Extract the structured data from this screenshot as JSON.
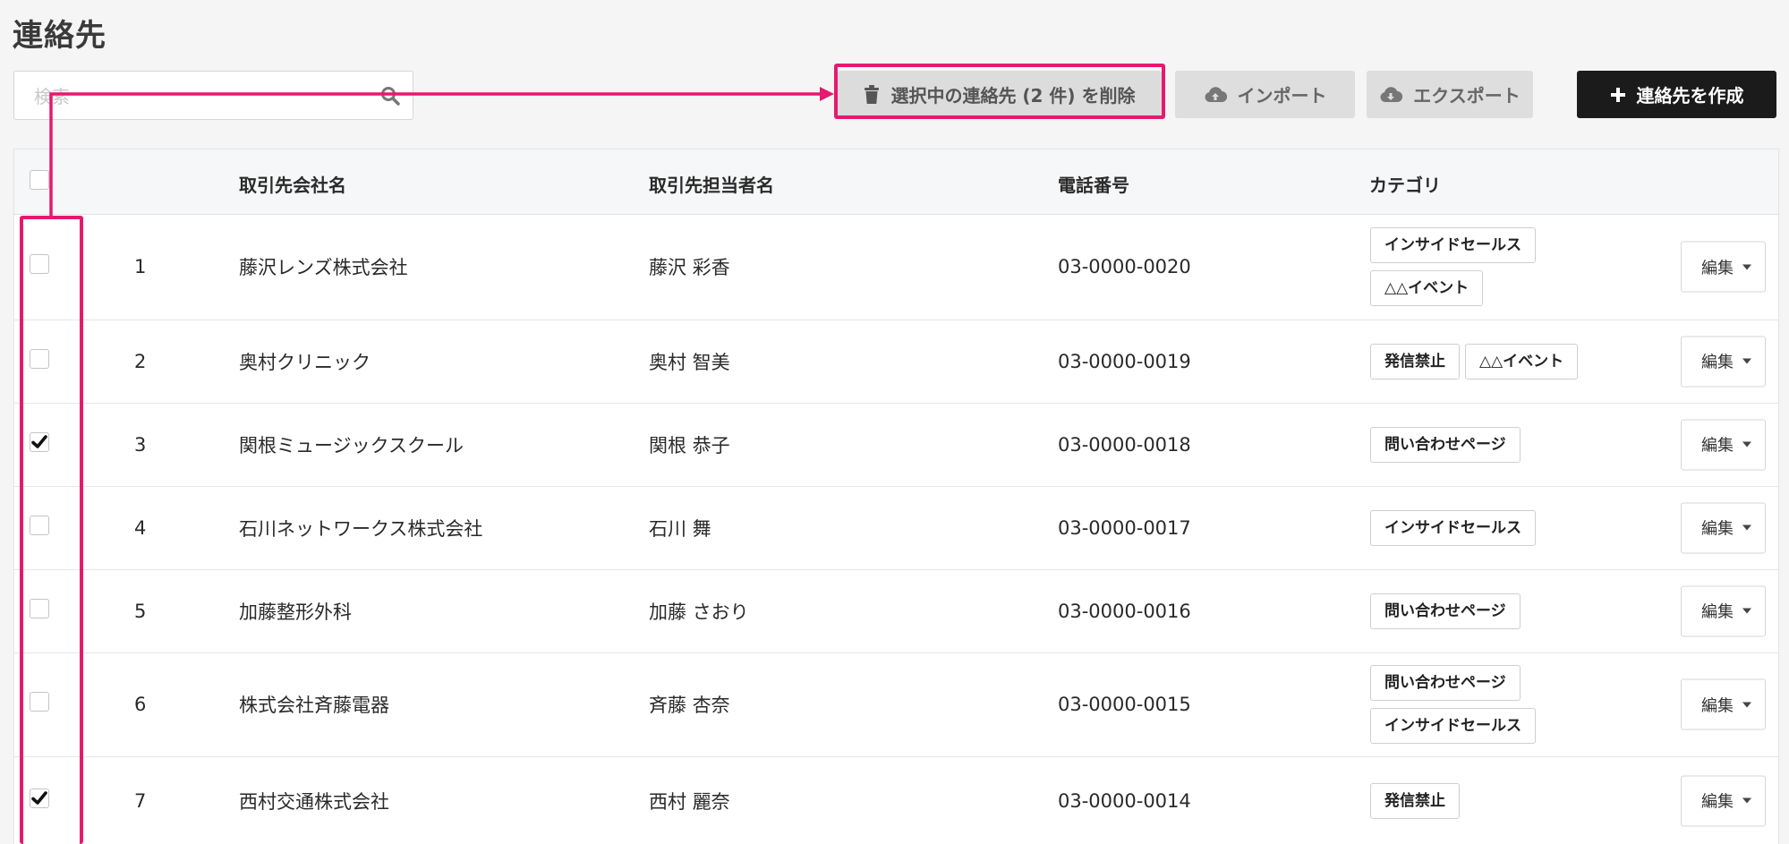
{
  "page": {
    "title": "連絡先"
  },
  "search": {
    "placeholder": "検索"
  },
  "toolbar": {
    "delete_label": "選択中の連絡先 (2 件) を削除",
    "import_label": "インポート",
    "export_label": "エクスポート",
    "create_label": "連絡先を作成"
  },
  "table": {
    "headers": {
      "company": "取引先会社名",
      "contact": "取引先担当者名",
      "phone": "電話番号",
      "category": "カテゴリ"
    },
    "edit_label": "編集",
    "rows": [
      {
        "no": "1",
        "company": "藤沢レンズ株式会社",
        "contact": "藤沢 彩香",
        "phone": "03-0000-0020",
        "checked": false,
        "tags": [
          "インサイドセールス",
          "△△イベント"
        ]
      },
      {
        "no": "2",
        "company": "奥村クリニック",
        "contact": "奥村 智美",
        "phone": "03-0000-0019",
        "checked": false,
        "tags": [
          "発信禁止",
          "△△イベント"
        ]
      },
      {
        "no": "3",
        "company": "関根ミュージックスクール",
        "contact": "関根 恭子",
        "phone": "03-0000-0018",
        "checked": true,
        "tags": [
          "問い合わせページ"
        ]
      },
      {
        "no": "4",
        "company": "石川ネットワークス株式会社",
        "contact": "石川 舞",
        "phone": "03-0000-0017",
        "checked": false,
        "tags": [
          "インサイドセールス"
        ]
      },
      {
        "no": "5",
        "company": "加藤整形外科",
        "contact": "加藤 さおり",
        "phone": "03-0000-0016",
        "checked": false,
        "tags": [
          "問い合わせページ"
        ]
      },
      {
        "no": "6",
        "company": "株式会社斉藤電器",
        "contact": "斉藤 杏奈",
        "phone": "03-0000-0015",
        "checked": false,
        "tags": [
          "問い合わせページ",
          "インサイドセールス"
        ]
      },
      {
        "no": "7",
        "company": "西村交通株式会社",
        "contact": "西村 麗奈",
        "phone": "03-0000-0014",
        "checked": true,
        "tags": [
          "発信禁止"
        ]
      }
    ]
  },
  "colors": {
    "annotation": "#e6196f",
    "create_button": "#1b1b1b"
  }
}
